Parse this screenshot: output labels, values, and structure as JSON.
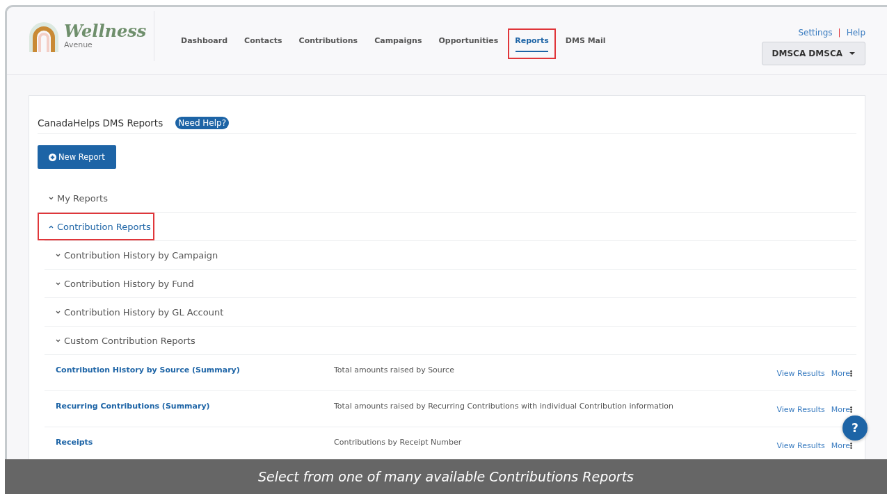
{
  "brand": {
    "name": "Wellness",
    "tagline": "Avenue"
  },
  "nav": [
    {
      "label": "Dashboard",
      "selected": false,
      "highlighted": false
    },
    {
      "label": "Contacts",
      "selected": false,
      "highlighted": false
    },
    {
      "label": "Contributions",
      "selected": false,
      "highlighted": false
    },
    {
      "label": "Campaigns",
      "selected": false,
      "highlighted": false
    },
    {
      "label": "Opportunities",
      "selected": false,
      "highlighted": false
    },
    {
      "label": "Reports",
      "selected": true,
      "highlighted": true
    },
    {
      "label": "DMS Mail",
      "selected": false,
      "highlighted": false
    }
  ],
  "top_links": [
    "Settings",
    "Help"
  ],
  "top_links_separator": "|",
  "user_menu": {
    "label": "DMSCA DMSCA"
  },
  "page": {
    "title": "CanadaHelps DMS Reports",
    "help_badge": "Need Help?",
    "new_button": "New Report"
  },
  "sections": [
    {
      "label": "My Reports",
      "expanded": false,
      "highlighted": false
    },
    {
      "label": "Contribution Reports",
      "expanded": true,
      "highlighted": true,
      "children": [
        {
          "label": "Contribution History by Campaign",
          "expanded": false
        },
        {
          "label": "Contribution History by Fund",
          "expanded": false
        },
        {
          "label": "Contribution History by GL Account",
          "expanded": false
        },
        {
          "label": "Custom Contribution Reports",
          "expanded": false
        }
      ],
      "reports": [
        {
          "name": "Contribution History by Source (Summary)",
          "description": "Total amounts raised by Source",
          "view": "View Results",
          "more": "More"
        },
        {
          "name": "Recurring Contributions (Summary)",
          "description": "Total amounts raised by Recurring Contributions with individual Contribution information",
          "view": "View Results",
          "more": "More"
        },
        {
          "name": "Receipts",
          "description": "Contributions by Receipt Number",
          "view": "View Results",
          "more": "More"
        }
      ]
    }
  ],
  "help_fab": "?",
  "caption": "Select from one of many available Contributions Reports"
}
